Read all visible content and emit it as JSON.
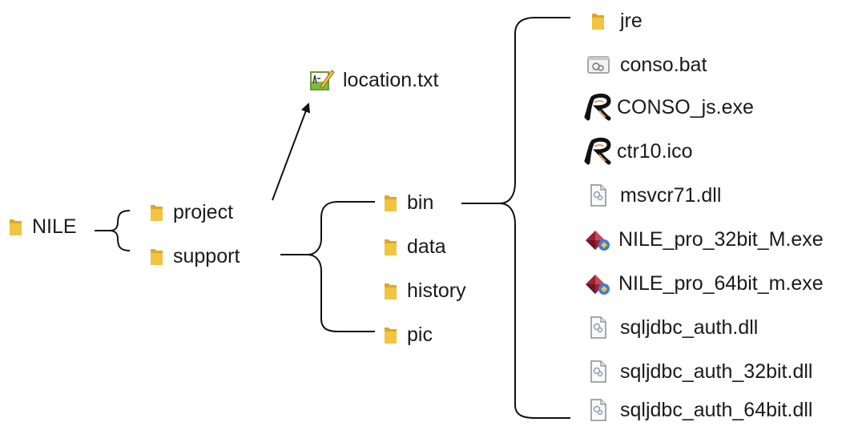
{
  "colors": {
    "folder": "#f2c440",
    "folder_dark": "#dea727",
    "line": "#111111",
    "r_logo": "#111111",
    "r_logo_accent": "#d9a066"
  },
  "root": {
    "label": "NILE",
    "icon": "folder-icon"
  },
  "level1": [
    {
      "label": "project",
      "icon": "folder-icon"
    },
    {
      "label": "support",
      "icon": "folder-icon"
    }
  ],
  "project_file": {
    "label": "location.txt",
    "icon": "text-file-icon"
  },
  "support_children": [
    {
      "label": "bin",
      "icon": "folder-icon"
    },
    {
      "label": "data",
      "icon": "folder-icon"
    },
    {
      "label": "history",
      "icon": "folder-icon"
    },
    {
      "label": "pic",
      "icon": "folder-icon"
    }
  ],
  "bin_files": [
    {
      "label": "jre",
      "icon": "folder-icon"
    },
    {
      "label": "conso.bat",
      "icon": "batch-file-icon"
    },
    {
      "label": "CONSO_js.exe",
      "icon": "r-logo-icon"
    },
    {
      "label": "ctr10.ico",
      "icon": "r-logo-icon"
    },
    {
      "label": "msvcr71.dll",
      "icon": "dll-file-icon"
    },
    {
      "label": "NILE_pro_32bit_M.exe",
      "icon": "installer-icon"
    },
    {
      "label": "NILE_pro_64bit_m.exe",
      "icon": "installer-icon"
    },
    {
      "label": "sqljdbc_auth.dll",
      "icon": "dll-file-icon"
    },
    {
      "label": "sqljdbc_auth_32bit.dll",
      "icon": "dll-file-icon"
    },
    {
      "label": "sqljdbc_auth_64bit.dll",
      "icon": "dll-file-icon"
    }
  ]
}
